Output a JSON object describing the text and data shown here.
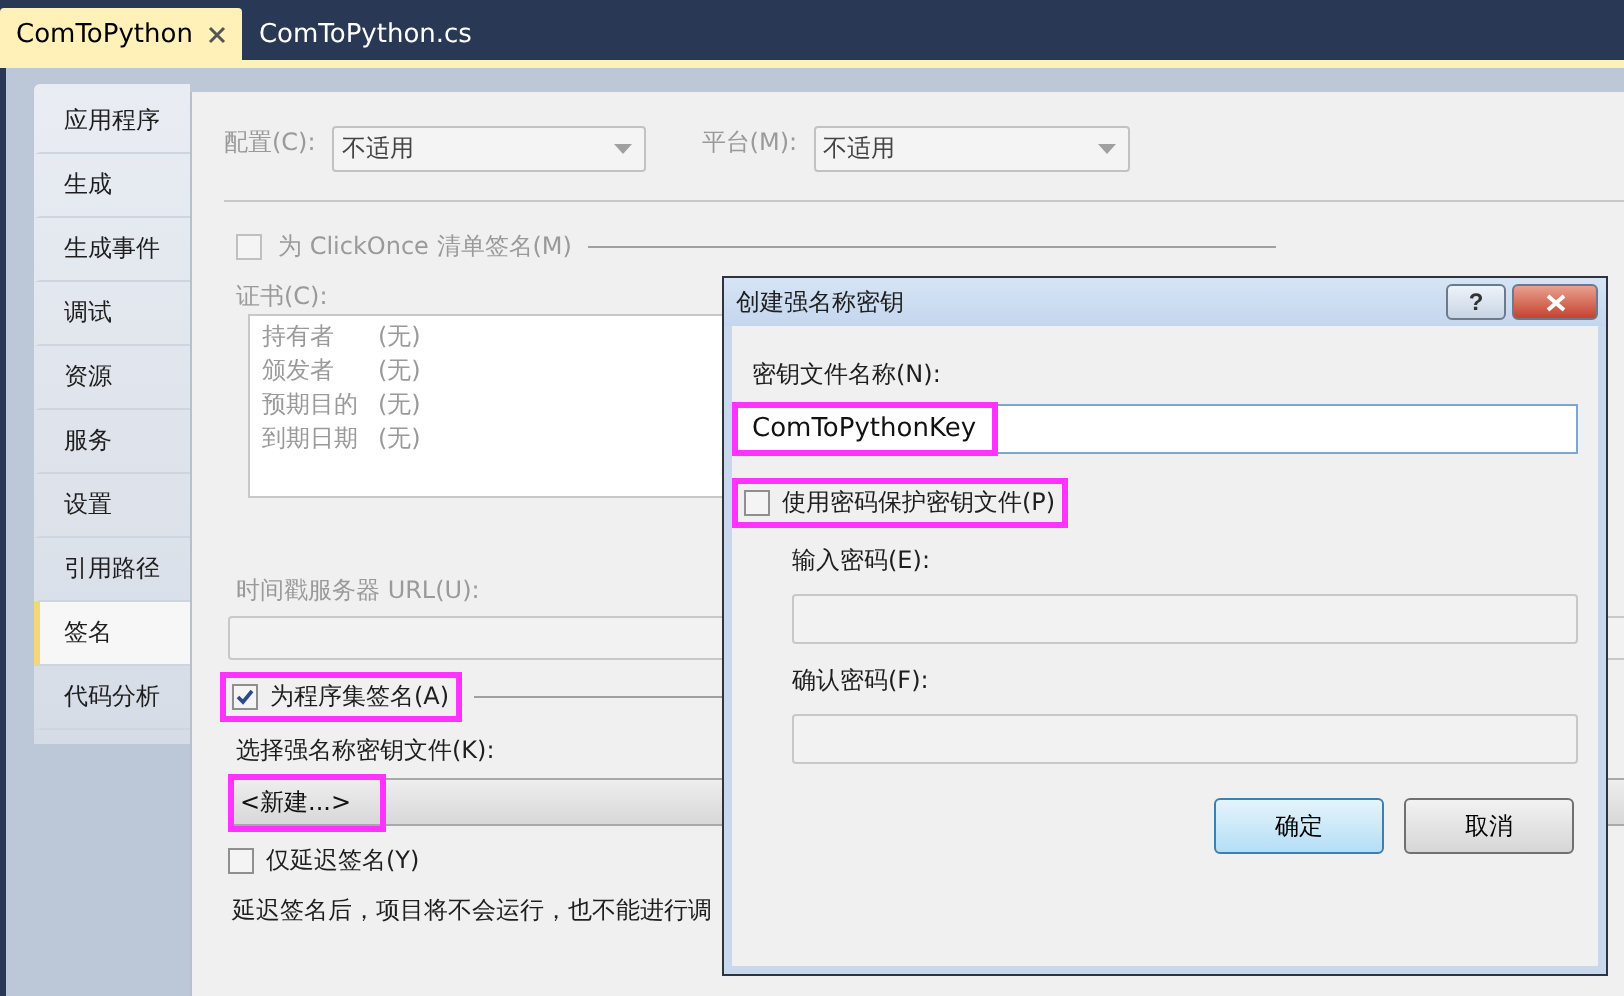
{
  "tabs": [
    {
      "label": "ComToPython",
      "selected": true,
      "closable": true
    },
    {
      "label": "ComToPython.cs",
      "selected": false,
      "closable": false
    }
  ],
  "sidebar": {
    "items": [
      {
        "label": "应用程序",
        "selected": false
      },
      {
        "label": "生成",
        "selected": false
      },
      {
        "label": "生成事件",
        "selected": false
      },
      {
        "label": "调试",
        "selected": false
      },
      {
        "label": "资源",
        "selected": false
      },
      {
        "label": "服务",
        "selected": false
      },
      {
        "label": "设置",
        "selected": false
      },
      {
        "label": "引用路径",
        "selected": false
      },
      {
        "label": "签名",
        "selected": true
      },
      {
        "label": "代码分析",
        "selected": false
      }
    ]
  },
  "signing": {
    "configuration": {
      "label": "配置(C):",
      "value": "不适用",
      "disabled": true
    },
    "platform": {
      "label": "平台(M):",
      "value": "不适用",
      "disabled": true
    },
    "clickonce": {
      "label": "为 ClickOnce 清单签名(M)",
      "checked": false,
      "disabled": true
    },
    "certificate": {
      "label": "证书(C):",
      "rows": [
        {
          "name": "持有者",
          "value": "(无)"
        },
        {
          "name": "颁发者",
          "value": "(无)"
        },
        {
          "name": "预期目的",
          "value": "(无)"
        },
        {
          "name": "到期日期",
          "value": "(无)"
        }
      ]
    },
    "timestamp": {
      "label": "时间戳服务器 URL(U):",
      "disabled": true
    },
    "sign_assembly": {
      "label": "为程序集签名(A)",
      "checked": true,
      "highlighted": true
    },
    "key_file": {
      "label": "选择强名称密钥文件(K):",
      "value": "<新建...>",
      "highlighted": true
    },
    "delay_sign": {
      "label": "仅延迟签名(Y)",
      "checked": false
    },
    "note": "延迟签名后，项目将不会运行，也不能进行调"
  },
  "dialog": {
    "title": "创建强名称密钥",
    "help_button": "?",
    "key_name": {
      "label": "密钥文件名称(N):",
      "value": "ComToPythonKey",
      "highlighted": true
    },
    "protect": {
      "label": "使用密码保护密钥文件(P)",
      "checked": false,
      "highlighted": true
    },
    "password": {
      "label": "输入密码(E):",
      "disabled": true
    },
    "confirm": {
      "label": "确认密码(F):",
      "disabled": true
    },
    "buttons": [
      {
        "label": "确定",
        "default": true
      },
      {
        "label": "取消",
        "default": false
      }
    ]
  }
}
